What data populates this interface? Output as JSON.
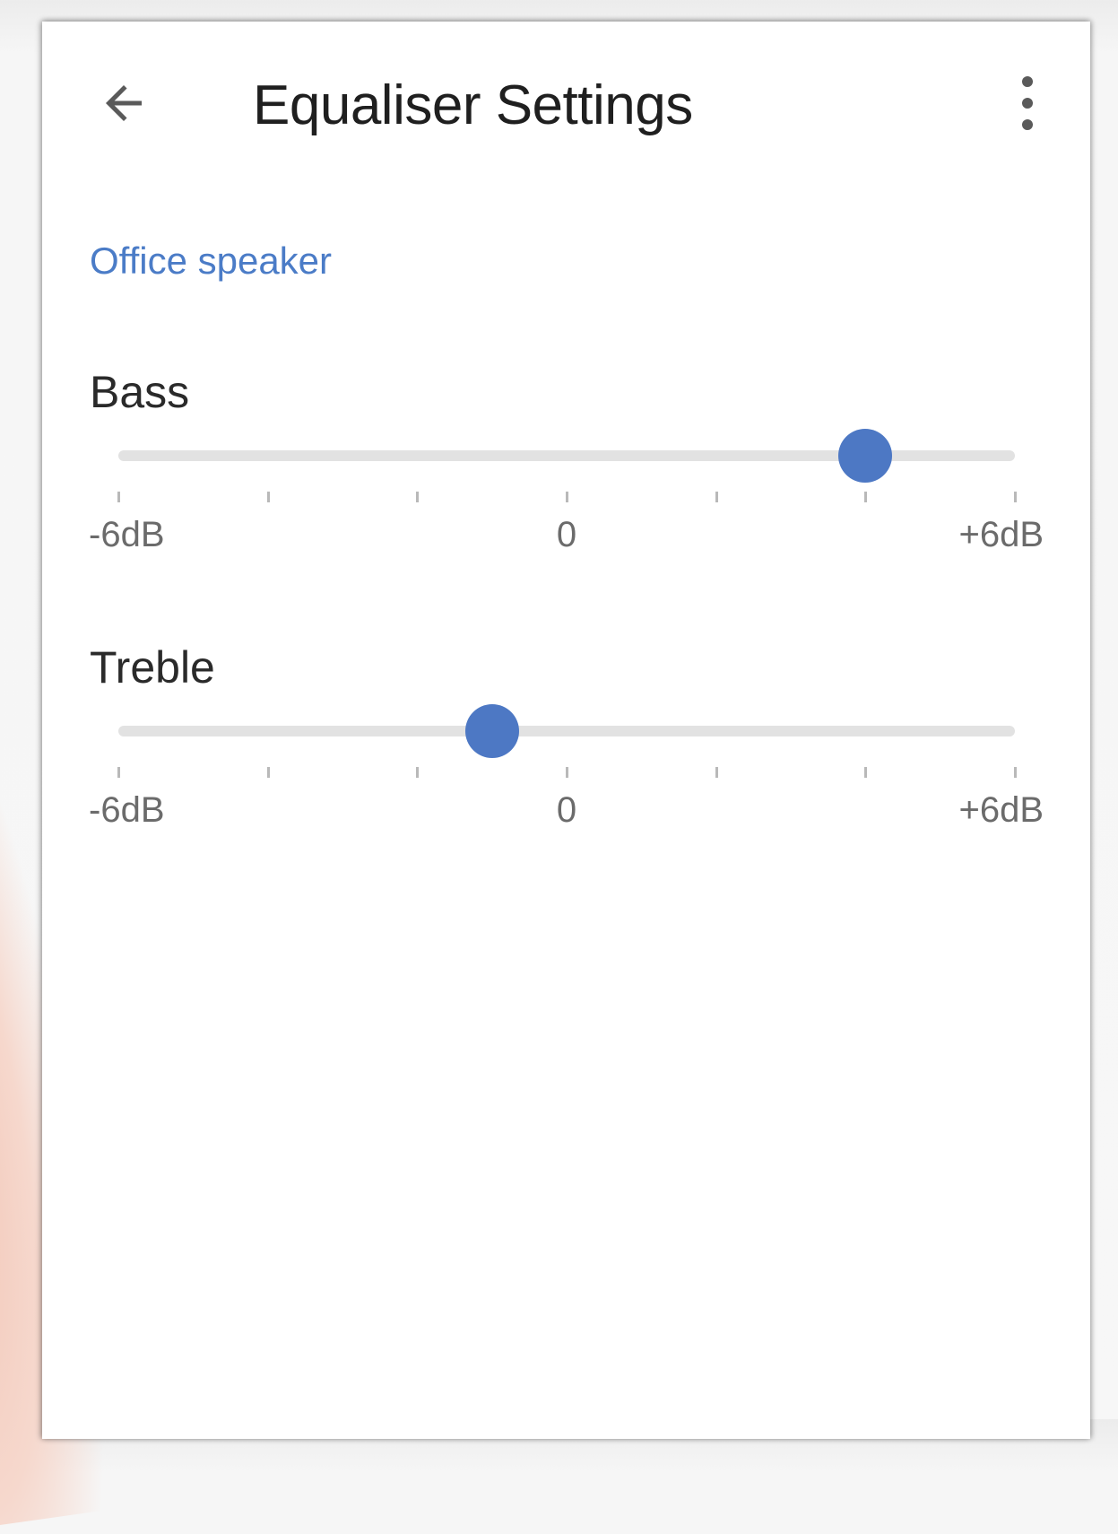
{
  "app_bar": {
    "title": "Equaliser Settings",
    "back_icon": "arrow-left-icon",
    "more_icon": "more-vert-icon"
  },
  "device": {
    "name": "Office speaker"
  },
  "equaliser": {
    "bass": {
      "label": "Bass",
      "min_label": "-6dB",
      "mid_label": "0",
      "max_label": "+6dB",
      "min_db": -6,
      "max_db": 6,
      "value_db": 4,
      "tick_count": 7
    },
    "treble": {
      "label": "Treble",
      "min_label": "-6dB",
      "mid_label": "0",
      "max_label": "+6dB",
      "min_db": -6,
      "max_db": 6,
      "value_db": -1,
      "tick_count": 7
    }
  },
  "colors": {
    "accent": "#4d78c4",
    "device_name": "#4b7cc7",
    "track": "#e2e2e2",
    "tick": "#b9b9b9"
  }
}
